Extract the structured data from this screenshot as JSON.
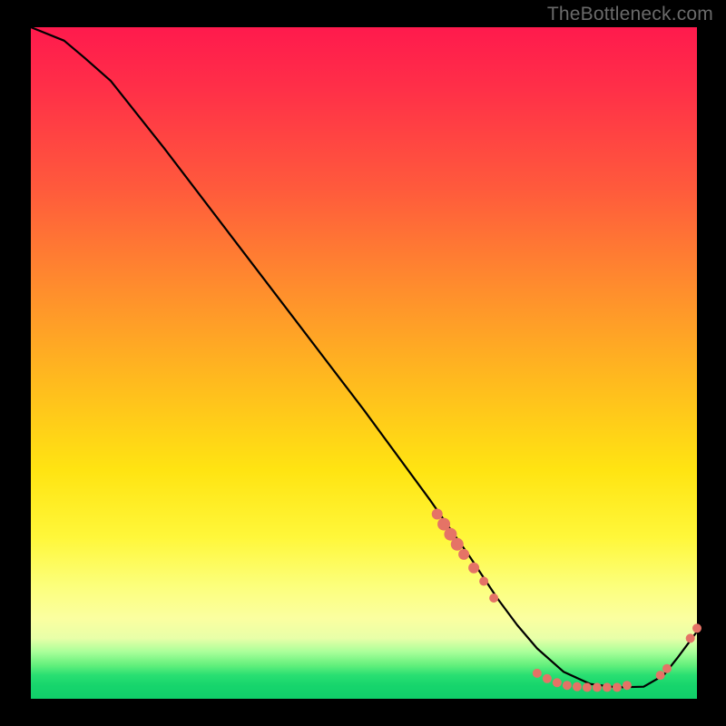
{
  "watermark": "TheBottleneck.com",
  "colors": {
    "marker": "#e57366",
    "curve": "#000000",
    "background": "#000000"
  },
  "chart_data": {
    "type": "line",
    "title": "",
    "xlabel": "",
    "ylabel": "",
    "xlim": [
      0,
      100
    ],
    "ylim": [
      0,
      100
    ],
    "grid": false,
    "legend": false,
    "axes_visible": false,
    "series": [
      {
        "name": "bottleneck-curve",
        "x": [
          0,
          5,
          8,
          12,
          20,
          30,
          40,
          50,
          60,
          66,
          70,
          73,
          76,
          80,
          84,
          88,
          92,
          95,
          97,
          100
        ],
        "y": [
          100,
          98,
          95.5,
          92,
          82,
          69,
          56,
          43,
          29.5,
          21,
          15,
          11,
          7.5,
          4,
          2.2,
          1.7,
          1.8,
          3.5,
          6,
          10
        ]
      }
    ],
    "highlight_clusters": [
      {
        "name": "descent-cluster",
        "points": [
          {
            "x": 61,
            "y": 27.5,
            "r": 6
          },
          {
            "x": 62,
            "y": 26,
            "r": 7
          },
          {
            "x": 63,
            "y": 24.5,
            "r": 7
          },
          {
            "x": 64,
            "y": 23,
            "r": 7
          },
          {
            "x": 65,
            "y": 21.5,
            "r": 6
          },
          {
            "x": 66.5,
            "y": 19.5,
            "r": 6
          },
          {
            "x": 68,
            "y": 17.5,
            "r": 5
          },
          {
            "x": 69.5,
            "y": 15,
            "r": 5
          }
        ]
      },
      {
        "name": "trough-cluster",
        "points": [
          {
            "x": 76,
            "y": 3.8,
            "r": 5
          },
          {
            "x": 77.5,
            "y": 3.0,
            "r": 5
          },
          {
            "x": 79,
            "y": 2.4,
            "r": 5
          },
          {
            "x": 80.5,
            "y": 2.0,
            "r": 5
          },
          {
            "x": 82,
            "y": 1.8,
            "r": 5
          },
          {
            "x": 83.5,
            "y": 1.7,
            "r": 5
          },
          {
            "x": 85,
            "y": 1.7,
            "r": 5
          },
          {
            "x": 86.5,
            "y": 1.7,
            "r": 5
          },
          {
            "x": 88,
            "y": 1.7,
            "r": 5
          },
          {
            "x": 89.5,
            "y": 2.0,
            "r": 5
          }
        ]
      },
      {
        "name": "ascent-cluster",
        "points": [
          {
            "x": 94.5,
            "y": 3.5,
            "r": 5
          },
          {
            "x": 95.5,
            "y": 4.5,
            "r": 5
          },
          {
            "x": 99,
            "y": 9.0,
            "r": 5
          },
          {
            "x": 100,
            "y": 10.5,
            "r": 5
          }
        ]
      }
    ]
  }
}
